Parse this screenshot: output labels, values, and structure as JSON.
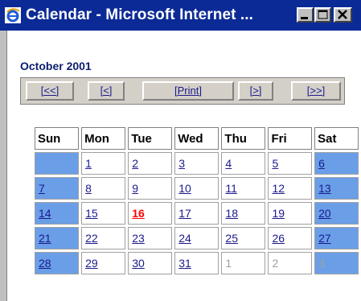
{
  "window": {
    "title": "Calendar - Microsoft Internet ..."
  },
  "calendar": {
    "month": "October 2001",
    "nav": {
      "prev_year": "[<<]",
      "prev_month": "[<]",
      "print": "[Print]",
      "next_month": "[>]",
      "next_year": "[>>]"
    },
    "days": [
      "Sun",
      "Mon",
      "Tue",
      "Wed",
      "Thu",
      "Fri",
      "Sat"
    ],
    "today": "16",
    "weeks": [
      [
        "",
        "1",
        "2",
        "3",
        "4",
        "5",
        "6"
      ],
      [
        "7",
        "8",
        "9",
        "10",
        "11",
        "12",
        "13"
      ],
      [
        "14",
        "15",
        "16",
        "17",
        "18",
        "19",
        "20"
      ],
      [
        "21",
        "22",
        "23",
        "24",
        "25",
        "26",
        "27"
      ],
      [
        "28",
        "29",
        "30",
        "31",
        "1",
        "2",
        "3"
      ]
    ]
  }
}
